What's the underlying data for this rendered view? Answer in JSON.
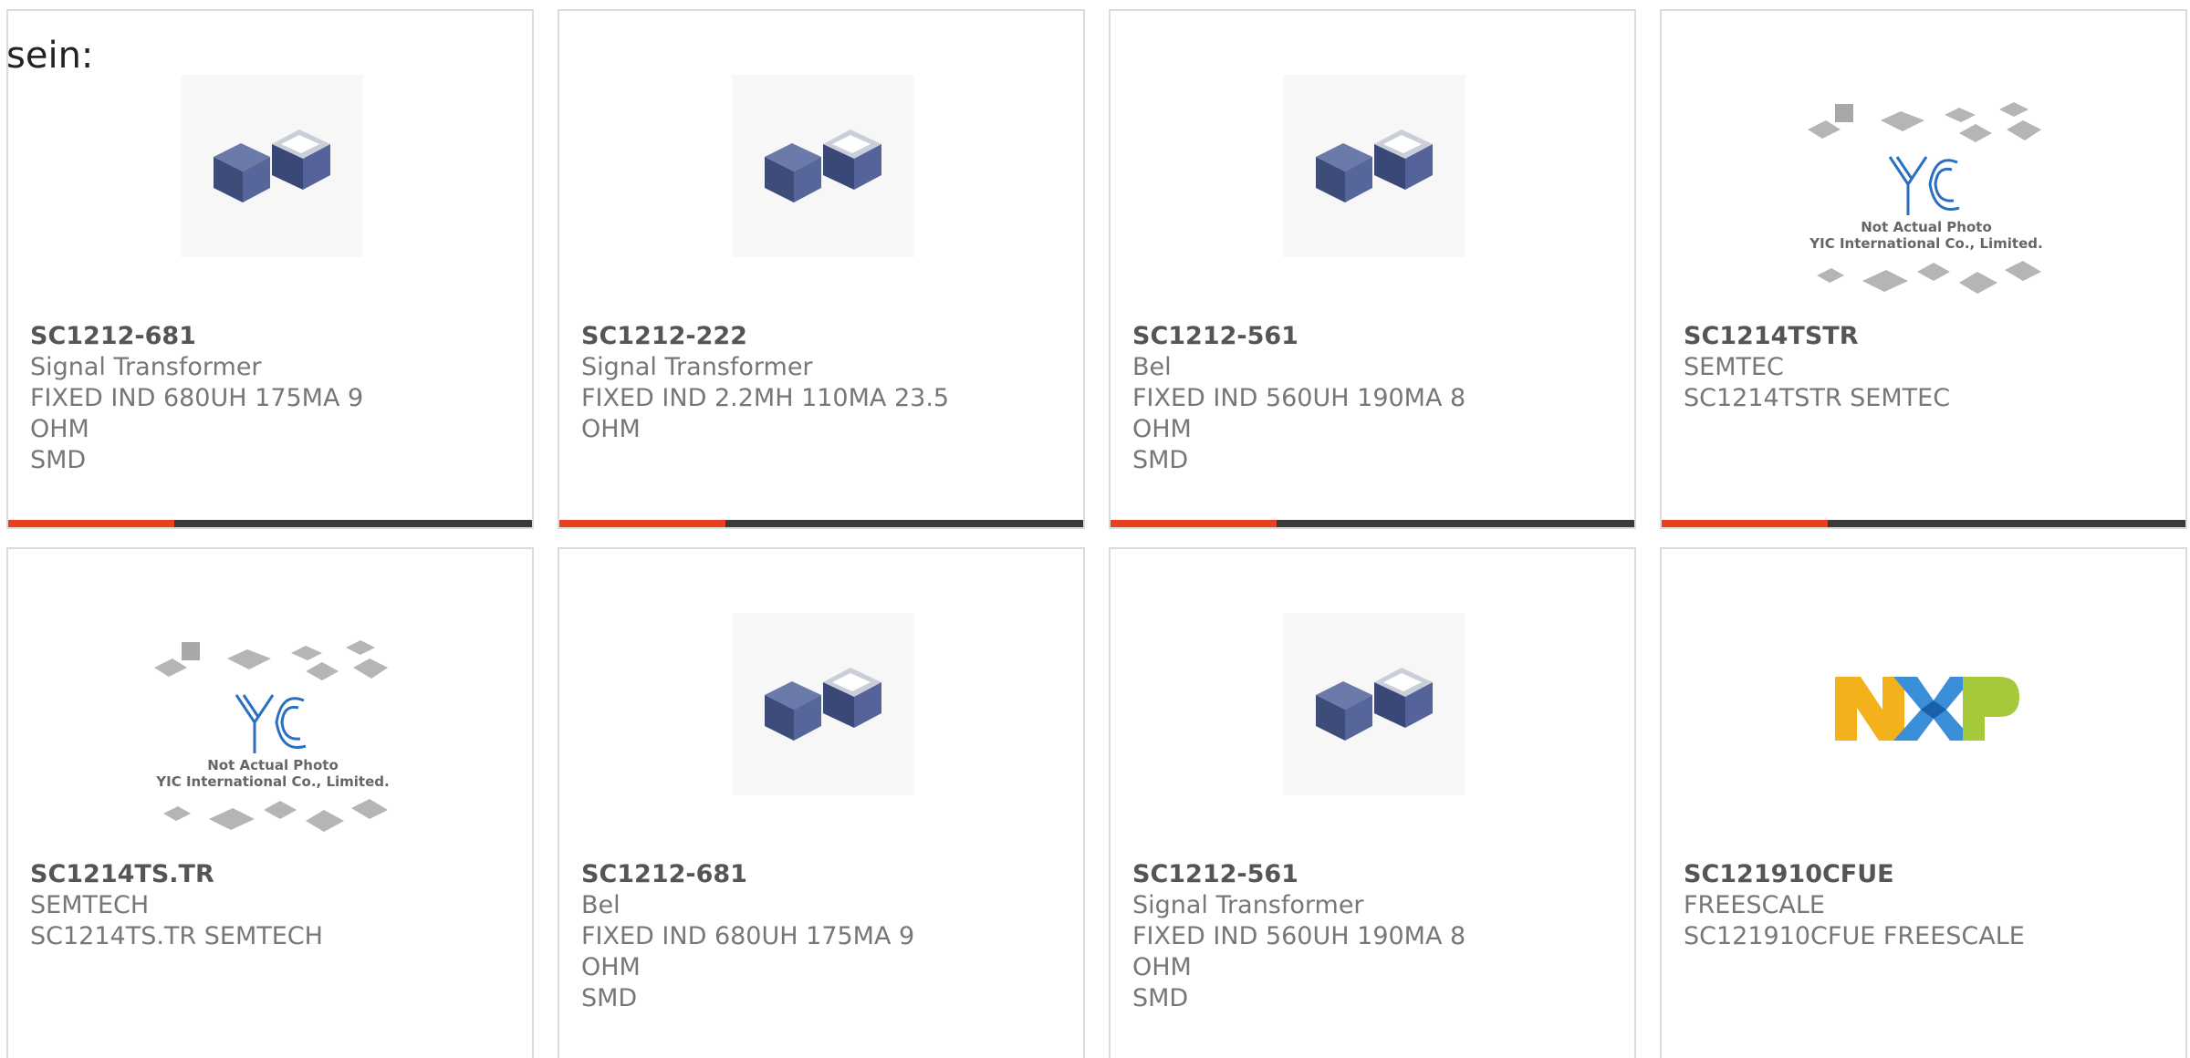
{
  "page_label": "sein:",
  "colors": {
    "accent": "#e8401c",
    "bar": "#3a3a3a",
    "border": "#dcdcdc"
  },
  "products": [
    {
      "part": "SC1212-681",
      "maker": "Signal Transformer",
      "desc1": "FIXED IND 680UH 175MA 9 OHM",
      "desc2": "SMD",
      "image": "inductor-photo-icon"
    },
    {
      "part": "SC1212-222",
      "maker": "Signal Transformer",
      "desc1": "FIXED IND 2.2MH 110MA 23.5",
      "desc2": "OHM",
      "image": "inductor-photo-icon"
    },
    {
      "part": "SC1212-561",
      "maker": "Bel",
      "desc1": "FIXED IND 560UH 190MA 8 OHM",
      "desc2": "SMD",
      "image": "inductor-photo-icon"
    },
    {
      "part": "SC1214TSTR",
      "maker": "SEMTEC",
      "desc1": "SC1214TSTR SEMTEC",
      "desc2": "",
      "image": "yic-placeholder-icon",
      "placeholder_line1": "Not Actual Photo",
      "placeholder_line2": "YIC International Co., Limited."
    },
    {
      "part": "SC1214TS.TR",
      "maker": "SEMTECH",
      "desc1": "SC1214TS.TR SEMTECH",
      "desc2": "",
      "image": "yic-placeholder-icon",
      "placeholder_line1": "Not Actual Photo",
      "placeholder_line2": "YIC International Co., Limited."
    },
    {
      "part": "SC1212-681",
      "maker": "Bel",
      "desc1": "FIXED IND 680UH 175MA 9 OHM",
      "desc2": "SMD",
      "image": "inductor-photo-icon"
    },
    {
      "part": "SC1212-561",
      "maker": "Signal Transformer",
      "desc1": "FIXED IND 560UH 190MA 8 OHM",
      "desc2": "SMD",
      "image": "inductor-photo-icon"
    },
    {
      "part": "SC121910CFUE",
      "maker": "FREESCALE",
      "desc1": "SC121910CFUE FREESCALE",
      "desc2": "",
      "image": "nxp-logo",
      "logo_text": "NXP"
    }
  ]
}
